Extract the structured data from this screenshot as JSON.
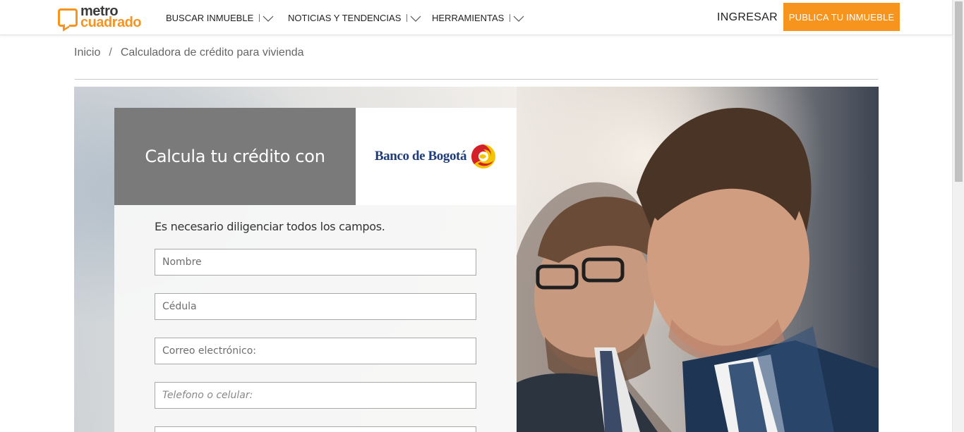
{
  "header": {
    "logo": {
      "line1": "metro",
      "line2": "cuadrado"
    },
    "nav": [
      {
        "label": "BUSCAR INMUEBLE"
      },
      {
        "label": "NOTICIAS Y TENDENCIAS"
      },
      {
        "label": "HERRAMIENTAS"
      }
    ],
    "login_label": "INGRESAR",
    "publish_label": "PUBLICA TU INMUEBLE"
  },
  "breadcrumb": {
    "home": "Inicio",
    "separator": "/",
    "current": "Calculadora de crédito para vivienda"
  },
  "hero": {
    "title": "Calcula tu crédito con",
    "bank_name": "Banco de Bogotá"
  },
  "form": {
    "note": "Es necesario diligenciar todos los campos.",
    "fields": [
      {
        "placeholder": "Nombre",
        "value": ""
      },
      {
        "placeholder": "Cédula",
        "value": ""
      },
      {
        "placeholder": "Correo electrónico:",
        "value": ""
      },
      {
        "placeholder": "Telefono o celular:",
        "value": ""
      }
    ]
  },
  "colors": {
    "brand_orange": "#f7941d",
    "title_box_gray": "#7a7a7a",
    "bank_blue": "#1c3d7a"
  },
  "icons": {
    "nav_dropdown": "chevron-down-icon",
    "logo": "speech-bubble-icon",
    "bank": "banco-de-bogota-logo"
  }
}
